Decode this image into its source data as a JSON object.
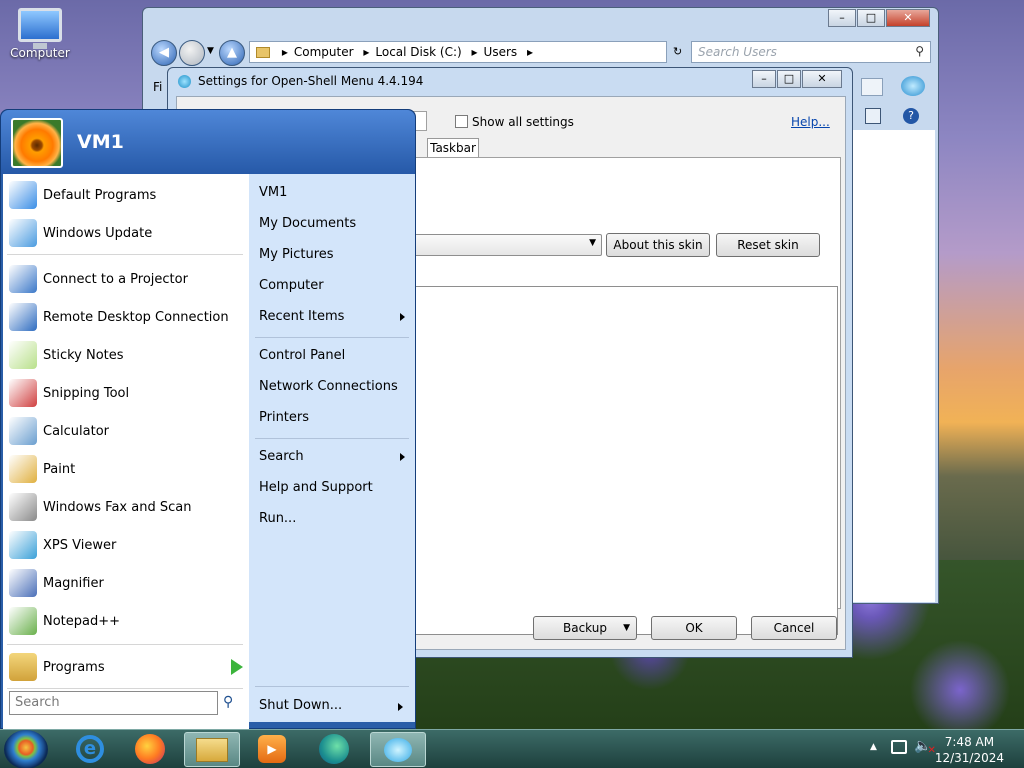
{
  "desktop": {
    "computer_label": "Computer"
  },
  "explorer": {
    "breadcrumb": [
      "Computer",
      "Local Disk (C:)",
      "Users"
    ],
    "search_placeholder": "Search Users",
    "menu_stub": "Fi",
    "caption": {
      "minimize": "–",
      "maximize": "□",
      "close": "✕"
    }
  },
  "settings_dialog": {
    "title": "Settings for Open-Shell Menu 4.4.194",
    "show_all_settings": "Show all settings",
    "help_link": "Help...",
    "tab_taskbar": "Taskbar",
    "about_skin": "About this skin",
    "reset_skin": "Reset skin",
    "backup": "Backup",
    "ok": "OK",
    "cancel": "Cancel",
    "caption": {
      "minimize": "–",
      "maximize": "□",
      "close": "✕"
    }
  },
  "start_menu": {
    "user": "VM1",
    "left_items": [
      {
        "label": "Default Programs",
        "icon": "default-programs-icon",
        "color": "#3a8ee6"
      },
      {
        "label": "Windows Update",
        "icon": "windows-update-icon",
        "color": "#4a9be0"
      },
      {
        "label": "Connect to a Projector",
        "icon": "projector-icon",
        "color": "#3b78c8"
      },
      {
        "label": "Remote Desktop Connection",
        "icon": "remote-desktop-icon",
        "color": "#2e6cc0"
      },
      {
        "label": "Sticky Notes",
        "icon": "sticky-notes-icon",
        "color": "#b8e08a"
      },
      {
        "label": "Snipping Tool",
        "icon": "snipping-tool-icon",
        "color": "#d04040"
      },
      {
        "label": "Calculator",
        "icon": "calculator-icon",
        "color": "#6a9ecf"
      },
      {
        "label": "Paint",
        "icon": "paint-icon",
        "color": "#e0b040"
      },
      {
        "label": "Windows Fax and Scan",
        "icon": "fax-scan-icon",
        "color": "#8a8a8a"
      },
      {
        "label": "XPS Viewer",
        "icon": "xps-viewer-icon",
        "color": "#3aa0d8"
      },
      {
        "label": "Magnifier",
        "icon": "magnifier-icon",
        "color": "#4a6fb8"
      },
      {
        "label": "Notepad++",
        "icon": "notepadpp-icon",
        "color": "#6ab04c"
      }
    ],
    "programs": "Programs",
    "search_placeholder": "Search",
    "right_items": [
      "VM1",
      "My Documents",
      "My Pictures",
      "Computer",
      "Recent Items",
      "Control Panel",
      "Network Connections",
      "Printers",
      "Search",
      "Help and Support",
      "Run..."
    ],
    "shutdown": "Shut Down..."
  },
  "taskbar": {
    "time": "7:48 AM",
    "date": "12/31/2024"
  }
}
